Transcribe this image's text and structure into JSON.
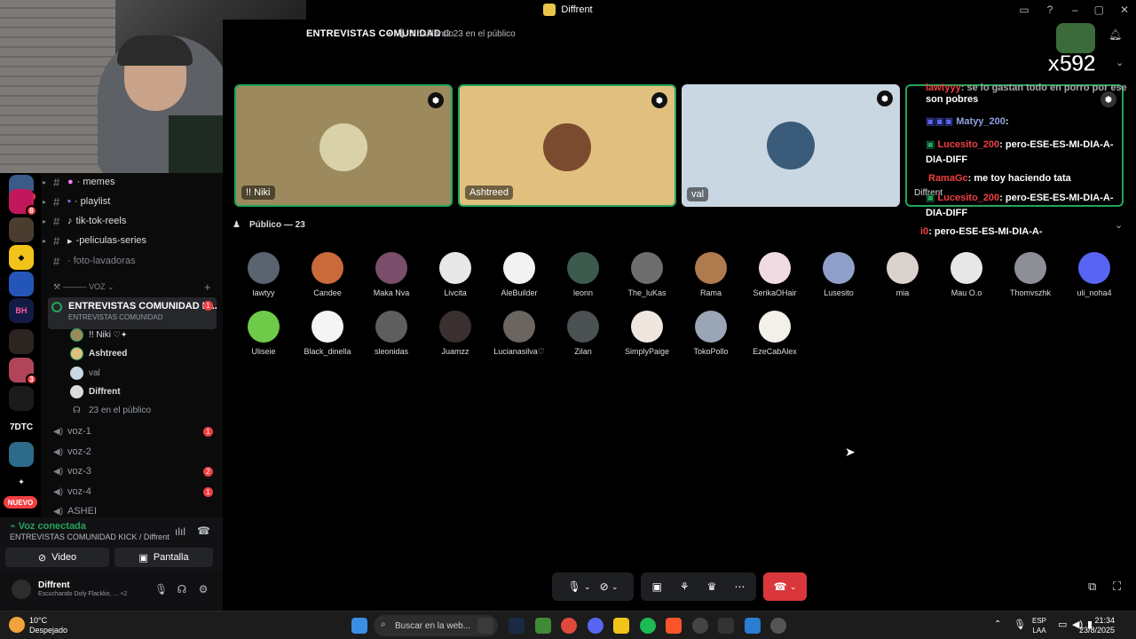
{
  "window": {
    "title": "Diffrent"
  },
  "stream_overlay": {
    "multiplier": "x592",
    "overlay_name": "Diffrent"
  },
  "header": {
    "title": "ENTREVISTAS COMUNIDAD",
    "speaking": "4 hablando",
    "audience": "23 en el público"
  },
  "server_rail": {
    "nuevo_label": "NUEVO",
    "server_7dtc": "7DTC",
    "badges": [
      "8",
      "8",
      "3"
    ]
  },
  "channels": {
    "text": [
      {
        "label": "memes",
        "prefix": "·"
      },
      {
        "label": "playlist",
        "prefix": "·"
      },
      {
        "label": "tik-tok-reels",
        "prefix": ""
      },
      {
        "label": "-peliculas-series",
        "prefix": "·"
      },
      {
        "label": "foto-lavadoras",
        "prefix": "·"
      }
    ],
    "voice_section": "VOZ",
    "active_voice": {
      "title": "ENTREVISTAS COMUNIDAD K...",
      "subtitle": "ENTREVISTAS COMUNIDAD",
      "badge": "1"
    },
    "voice_users": [
      "!! Niki",
      "Ashtreed",
      "val",
      "Diffrent"
    ],
    "audience_count": "23 en el público",
    "voice_channels": [
      {
        "label": "voz-1",
        "badge": "1"
      },
      {
        "label": "voz-2",
        "badge": ""
      },
      {
        "label": "voz-3",
        "badge": "2"
      },
      {
        "label": "voz-4",
        "badge": "1"
      },
      {
        "label": "ASHEI",
        "badge": ""
      }
    ]
  },
  "voice_panel": {
    "status": "Voz conectada",
    "channel": "ENTREVISTAS COMUNIDAD KICK / Diffrent",
    "video_label": "Video",
    "screen_label": "Pantalla"
  },
  "user": {
    "name": "Diffrent",
    "status": "Escuchando Doly Flackko, ...",
    "extra": "+2"
  },
  "stage_tiles": [
    {
      "name": "!! Niki",
      "bg": "#9c8a5e"
    },
    {
      "name": "Ashtreed",
      "bg": "#e1c07f"
    },
    {
      "name": "val",
      "bg": "#c9d7e3"
    }
  ],
  "chat": [
    {
      "user": "lawtyyy",
      "text": ": se lo gastan todo en porro por ese"
    },
    {
      "user": "",
      "text": "son pobres"
    },
    {
      "user": "Matyy_200",
      "text": ":"
    },
    {
      "user": "Lucesito_200",
      "text": ": pero-ESE-ES-MI-DIA-A-"
    },
    {
      "user": "",
      "text": "DIA-DIFF"
    },
    {
      "user": "RamaGc",
      "text": ": me toy haciendo tata"
    },
    {
      "user": "Lucesito_200",
      "text": ": pero-ESE-ES-MI-DIA-A-"
    },
    {
      "user": "",
      "text": "DIA-DIFF"
    },
    {
      "user": "i0",
      "text": ": pero-ESE-ES-MI-DIA-A-"
    }
  ],
  "public": {
    "header": "Público — 23"
  },
  "audience": [
    {
      "name": "lawtyy",
      "color": "#5a6470"
    },
    {
      "name": "Candee",
      "color": "#c96a3b"
    },
    {
      "name": "Maka Nva",
      "color": "#7a4d6b"
    },
    {
      "name": "Livcita",
      "color": "#e8e8e8"
    },
    {
      "name": "AleBuilder",
      "color": "#f2f2f2"
    },
    {
      "name": "leonn",
      "color": "#3e5a4e"
    },
    {
      "name": "The_luKas",
      "color": "#6d6d6d"
    },
    {
      "name": "Rama",
      "color": "#b07a4f"
    },
    {
      "name": "SerikaOHair",
      "color": "#f1dbe3"
    },
    {
      "name": "Lusesito",
      "color": "#8fa0c8"
    },
    {
      "name": "mia",
      "color": "#d9d2cf"
    },
    {
      "name": "Mau O.o",
      "color": "#e7e7e7"
    },
    {
      "name": "Thomvszhk",
      "color": "#8c8f95"
    },
    {
      "name": "uli_noha4",
      "color": "#5865f2"
    },
    {
      "name": "Uliseie",
      "color": "#6ecb4a"
    },
    {
      "name": "Black_dinella",
      "color": "#f4f4f4"
    },
    {
      "name": "sleonidas",
      "color": "#5e5e5e"
    },
    {
      "name": "Juamzz",
      "color": "#3b3030"
    },
    {
      "name": "Lucianasilva♡",
      "color": "#6a6560"
    },
    {
      "name": "Zilan",
      "color": "#4b5052"
    },
    {
      "name": "SimplyPaige",
      "color": "#efe6df"
    },
    {
      "name": "TokoPollo",
      "color": "#9aa6b5"
    },
    {
      "name": "EzeCabAlex",
      "color": "#f3f0ea"
    }
  ],
  "taskbar": {
    "weather_temp": "10°C",
    "weather_desc": "Despejado",
    "search_placeholder": "Buscar en la web...",
    "lang_1": "ESP",
    "lang_2": "LAA",
    "time": "21:34",
    "date": "23/8/2025"
  },
  "colors": {
    "accent_green": "#23a55a",
    "danger": "#da373c",
    "discord_blurple": "#5865f2"
  }
}
